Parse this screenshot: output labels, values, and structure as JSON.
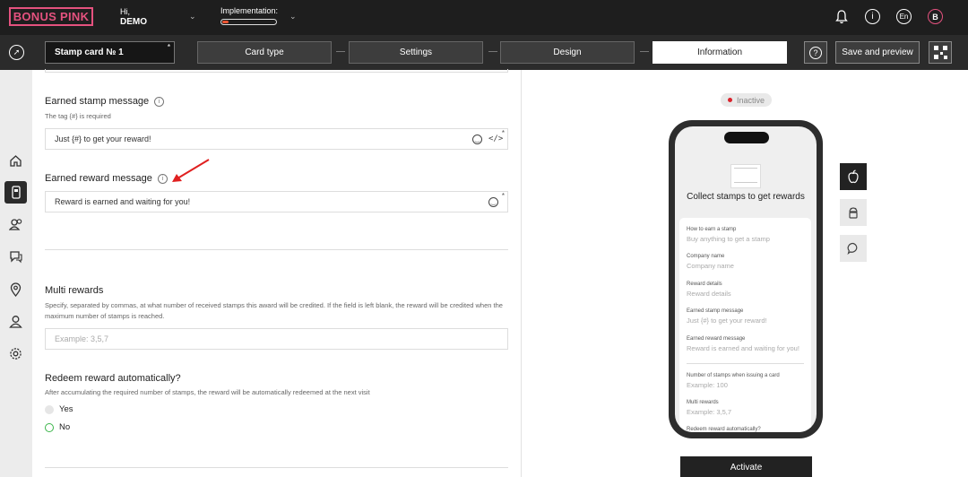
{
  "header": {
    "logo": "BONUS PINK",
    "greeting": "Hi,",
    "user": "DEMO",
    "implementation_label": "Implementation:",
    "implementation_progress": 0.12,
    "language": "En",
    "avatar_letter": "B",
    "icons": [
      "bell-icon",
      "info-icon",
      "language-icon",
      "avatar"
    ]
  },
  "toolbar": {
    "card_name": "Stamp card № 1",
    "required_mark": "*",
    "tabs": [
      {
        "label": "Card type"
      },
      {
        "label": "Settings"
      },
      {
        "label": "Design"
      },
      {
        "label": "Information",
        "active": true
      }
    ],
    "help_label": "?",
    "save_label": "Save and preview"
  },
  "sidenav": {
    "items": [
      "home-icon",
      "card-icon",
      "users-icon",
      "chat-icon",
      "location-icon",
      "profile-icon",
      "settings-icon"
    ],
    "active": "card-icon"
  },
  "form": {
    "earned_stamp": {
      "label": "Earned stamp message",
      "hint": "The tag {#} is required",
      "value": "Just {#} to get your reward!",
      "required": "*"
    },
    "earned_reward": {
      "label": "Earned reward message",
      "value": "Reward is earned and waiting for you!",
      "required": "*"
    },
    "multi_rewards": {
      "label": "Multi rewards",
      "hint": "Specify, separated by commas, at what number of received stamps this award will be credited. If the field is left blank, the reward will be credited when the maximum number of stamps is reached.",
      "placeholder": "Example: 3,5,7"
    },
    "redeem": {
      "label": "Redeem reward automatically?",
      "hint": "After accumulating the required number of stamps, the reward will be automatically redeemed at the next visit",
      "options": [
        {
          "label": "Yes",
          "selected": false
        },
        {
          "label": "No",
          "selected": true
        }
      ]
    }
  },
  "preview": {
    "status": "Inactive",
    "headline": "Collect stamps to get rewards",
    "fields": [
      {
        "label": "How to earn a stamp",
        "value": "Buy anything to get a stamp"
      },
      {
        "label": "Company name",
        "value": "Company name"
      },
      {
        "label": "Reward details",
        "value": "Reward details"
      },
      {
        "label": "Earned stamp message",
        "value": "Just {#} to get your reward!"
      },
      {
        "label": "Earned reward message",
        "value": "Reward is earned and waiting for you!"
      },
      {
        "label": "Number of stamps when issuing a card",
        "value": "Example: 100"
      },
      {
        "label": "Multi rewards",
        "value": "Example: 3,5,7"
      },
      {
        "label": "Redeem reward automatically?",
        "value": ""
      }
    ],
    "platforms": [
      "apple-icon",
      "android-icon",
      "chat-icon"
    ],
    "activate_label": "Activate"
  },
  "colors": {
    "brand": "#e5527f",
    "status_inactive": "#d9232d",
    "radio_selected": "#3bb54a",
    "annotation_arrow": "#e02020"
  }
}
